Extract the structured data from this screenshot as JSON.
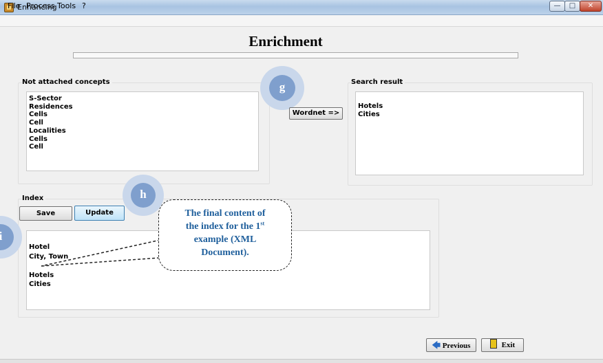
{
  "window": {
    "title": "Enhancing",
    "min_glyph": "—",
    "max_glyph": "□",
    "close_glyph": "✕"
  },
  "menu": [
    "File",
    "Process",
    "Tools",
    "?"
  ],
  "page": {
    "heading": "Enrichment",
    "progress_fraction": 0.0
  },
  "not_attached": {
    "label": "Not attached concepts",
    "items": [
      "S-Sector",
      "Residences",
      "Cells",
      "Cell",
      "Localities",
      "Cells",
      "Cell"
    ]
  },
  "wordnet_button": "Wordnet =>",
  "search_result": {
    "label": "Search result",
    "items": [
      "Hotels",
      "Cities"
    ]
  },
  "index": {
    "label": "Index",
    "save_label": "Save",
    "update_label": "Update",
    "lines": [
      "Hotel",
      "City, Town",
      "",
      "Hotels",
      "Cities"
    ]
  },
  "annotations": {
    "g": "g",
    "h": "h",
    "i": "i",
    "callout_line1": "The final content of",
    "callout_line2_pre": "the index for the 1",
    "callout_sup": "st",
    "callout_line3": "example (XML",
    "callout_line4": "Document)."
  },
  "nav": {
    "previous_label": "Previous",
    "exit_label": "Exit"
  },
  "colors": {
    "accent": "#3c7fb1",
    "callout_text": "#1f5f9c",
    "badge": "#7f9fcd"
  }
}
